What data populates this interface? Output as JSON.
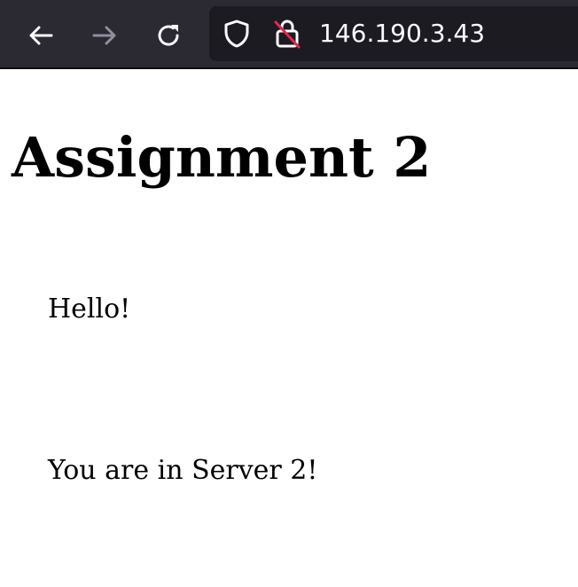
{
  "browser": {
    "url": "146.190.3.43",
    "icons": {
      "back": "arrow-left-icon",
      "forward": "arrow-right-icon",
      "reload": "reload-icon",
      "tracking_protection": "shield-icon",
      "insecure_connection": "lock-strikethrough-icon"
    },
    "colors": {
      "toolbar_bg": "#2b2a33",
      "urlbar_bg": "#1c1b22",
      "icon_active": "#fbfbfe",
      "icon_disabled": "#8f8f9d",
      "insecure_strike": "#e22850"
    }
  },
  "page": {
    "title": "Assignment 2",
    "paragraphs": [
      "Hello!",
      "You are in Server 2!"
    ]
  }
}
